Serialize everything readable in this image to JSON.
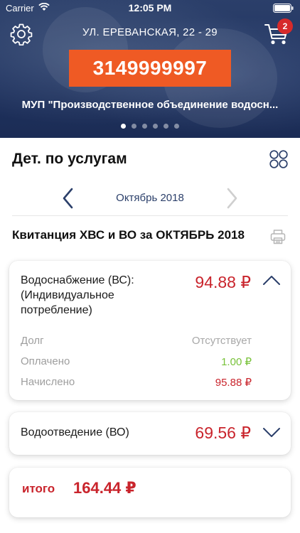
{
  "status_bar": {
    "carrier": "Carrier",
    "time": "12:05 PM"
  },
  "header": {
    "address": "УЛ. ЕРЕВАНСКАЯ, 22 - 29",
    "account_number": "3149999997",
    "organization": "МУП \"Производственное объединение водосн...",
    "cart_count": "2",
    "carousel": {
      "count": 6,
      "active_index": 0
    }
  },
  "section": {
    "title": "Дет. по услугам",
    "month": "Октябрь 2018",
    "receipt_title": "Квитанция ХВС и ВО за ОКТЯБРЬ 2018"
  },
  "services": [
    {
      "name": "Водоснабжение (ВС): (Индивидуальное потребление)",
      "amount": "94.88 ₽",
      "expanded": true,
      "details": [
        {
          "label": "Долг",
          "value": "Отсутствует"
        },
        {
          "label": "Оплачено",
          "value": "1.00 ₽"
        },
        {
          "label": "Начислено",
          "value": "95.88 ₽"
        }
      ]
    },
    {
      "name": "Водоотведение (ВО)",
      "amount": "69.56 ₽",
      "expanded": false
    }
  ],
  "total": {
    "label": "итого",
    "amount": "164.44 ₽"
  },
  "colors": {
    "accent_orange": "#ef5a24",
    "header_navy": "#203360",
    "amount_red": "#c9242c",
    "paid_green": "#78c23a",
    "badge_red": "#d62a2a"
  }
}
